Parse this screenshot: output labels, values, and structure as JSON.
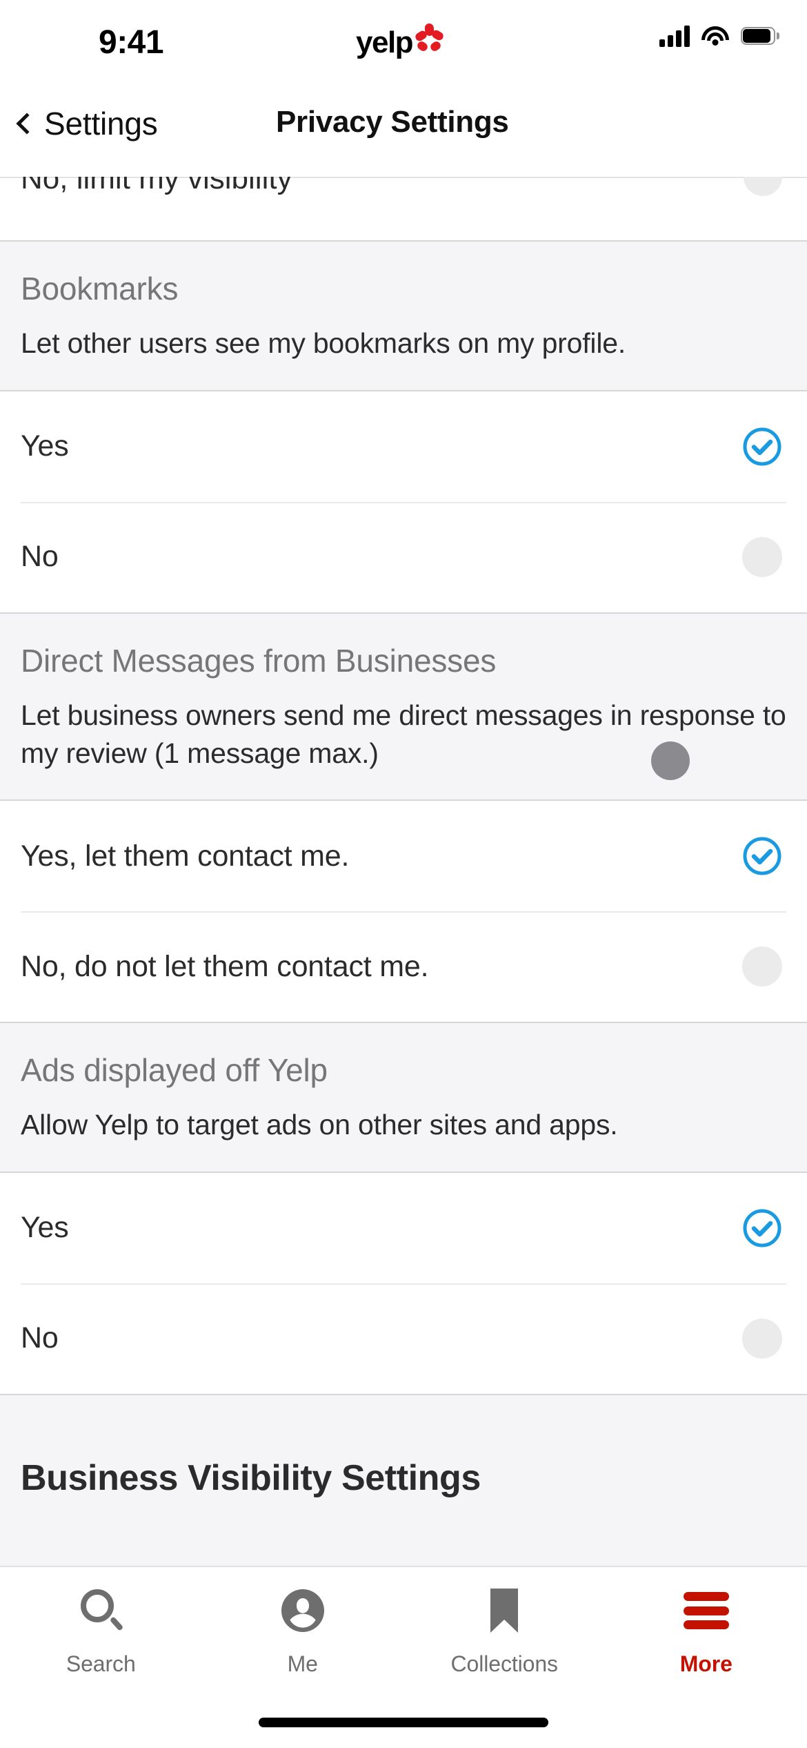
{
  "status_bar": {
    "time": "9:41",
    "brand_logo_text": "yelp",
    "icons": [
      "cellular-signal-icon",
      "wifi-icon",
      "battery-icon"
    ]
  },
  "nav_bar": {
    "back_label": "Settings",
    "back_icon": "chevron-left-icon",
    "title": "Privacy Settings"
  },
  "clipped_row": {
    "label": "No, limit my visibility",
    "selected": false
  },
  "sections": [
    {
      "title": "Bookmarks",
      "description": "Let other users see my bookmarks on my profile.",
      "options": [
        {
          "label": "Yes",
          "selected": true
        },
        {
          "label": "No",
          "selected": false
        }
      ]
    },
    {
      "title": "Direct Messages from Businesses",
      "description": "Let business owners send me direct messages in response to my review (1 message max.)",
      "options": [
        {
          "label": "Yes, let them contact me.",
          "selected": true
        },
        {
          "label": "No, do not let them contact me.",
          "selected": false
        }
      ]
    },
    {
      "title": "Ads displayed off Yelp",
      "description": "Allow Yelp to target ads on other sites and apps.",
      "options": [
        {
          "label": "Yes",
          "selected": true
        },
        {
          "label": "No",
          "selected": false
        }
      ]
    }
  ],
  "next_heading": "Business Visibility Settings",
  "tab_bar": {
    "tabs": [
      {
        "label": "Search",
        "icon": "search-icon",
        "active": false
      },
      {
        "label": "Me",
        "icon": "person-circle-icon",
        "active": false
      },
      {
        "label": "Collections",
        "icon": "bookmark-icon",
        "active": false
      },
      {
        "label": "More",
        "icon": "hamburger-menu-icon",
        "active": true
      }
    ]
  },
  "colors": {
    "accent_blue": "#1a9ae0",
    "yelp_red": "#C41200",
    "logo_red": "#E31B23",
    "section_bg": "#f5f4f6",
    "radio_off": "#ebebeb",
    "text_primary": "#2b2b2b",
    "text_muted": "#767676",
    "cursor_gray": "#8b8b8f"
  }
}
